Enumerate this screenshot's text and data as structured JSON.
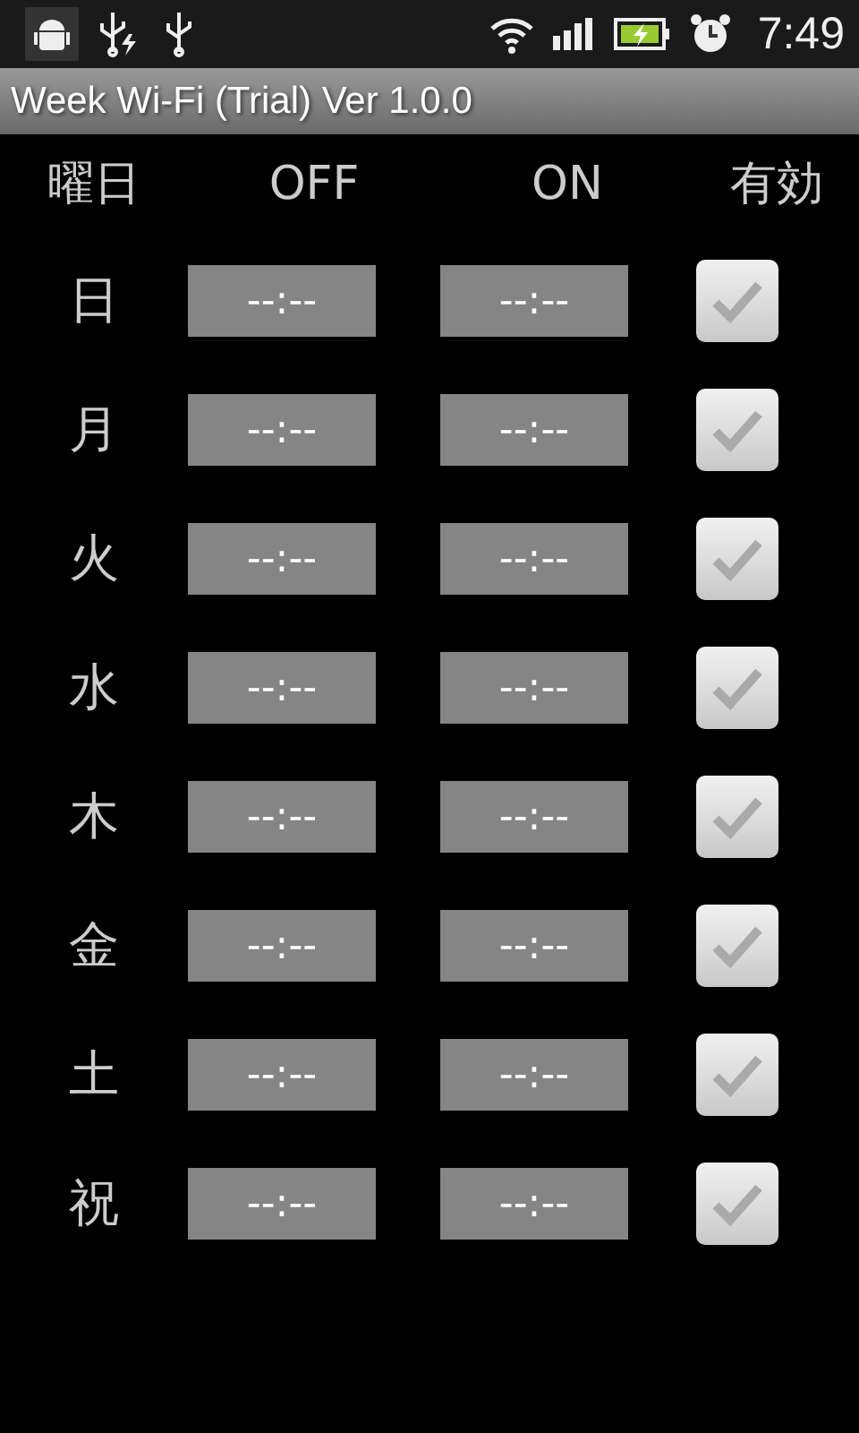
{
  "status_bar": {
    "time": "7:49"
  },
  "window": {
    "title": "Week Wi-Fi (Trial) Ver 1.0.0"
  },
  "columns": [
    "曜日",
    "OFF",
    "ON",
    "有効"
  ],
  "rows": [
    {
      "day": "日",
      "off": "--:--",
      "on": "--:--",
      "checked": false
    },
    {
      "day": "月",
      "off": "--:--",
      "on": "--:--",
      "checked": false
    },
    {
      "day": "火",
      "off": "--:--",
      "on": "--:--",
      "checked": false
    },
    {
      "day": "水",
      "off": "--:--",
      "on": "--:--",
      "checked": false
    },
    {
      "day": "木",
      "off": "--:--",
      "on": "--:--",
      "checked": false
    },
    {
      "day": "金",
      "off": "--:--",
      "on": "--:--",
      "checked": false
    },
    {
      "day": "土",
      "off": "--:--",
      "on": "--:--",
      "checked": false
    },
    {
      "day": "祝",
      "off": "--:--",
      "on": "--:--",
      "checked": false
    }
  ]
}
